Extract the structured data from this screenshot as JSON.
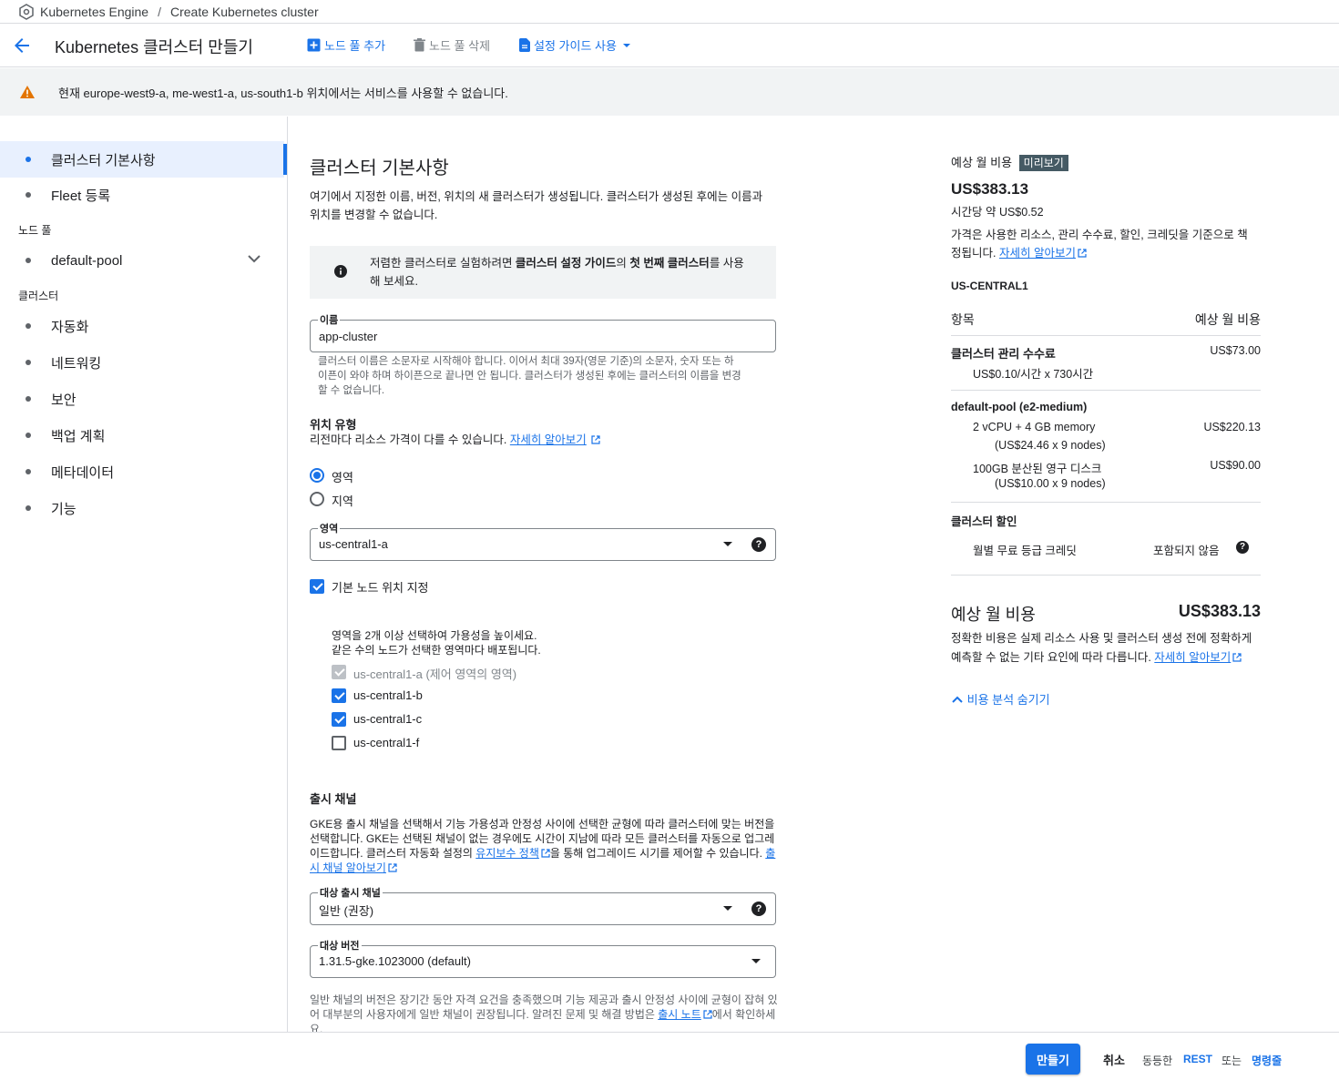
{
  "breadcrumb": {
    "product": "Kubernetes Engine",
    "separator": "/",
    "page": "Create Kubernetes cluster"
  },
  "header": {
    "title": "Kubernetes 클러스터 만들기",
    "add_pool": "노드 풀 추가",
    "delete_pool": "노드 풀 삭제",
    "setup_guide": "설정 가이드 사용"
  },
  "banner": {
    "text": "현재 europe-west9-a, me-west1-a, us-south1-b 위치에서는 서비스를 사용할 수 없습니다."
  },
  "nav": {
    "basics": "클러스터 기본사항",
    "fleet": "Fleet 등록",
    "nodepools_header": "노드 풀",
    "default_pool": "default-pool",
    "cluster_header": "클러스터",
    "automation": "자동화",
    "networking": "네트워킹",
    "security": "보안",
    "backup": "백업 계획",
    "metadata": "메타데이터",
    "features": "기능"
  },
  "form": {
    "heading": "클러스터 기본사항",
    "intro_1": "여기에서 지정한 이름, 버전, 위치의 새 클러스터가 생성됩니다. 클러스터가 생성된 후에는 이름과",
    "intro_2": "위치를 변경할 수 없습니다.",
    "info_line1_a": "저렴한 클러스터로 실험하려면 ",
    "info_line1_b": "클러스터 설정 가이드",
    "info_line1_c": "의 ",
    "info_line1_d": "첫 번째 클러스터",
    "info_line1_e": "를 사용",
    "info_line2": "해 보세요.",
    "name_label": "이름",
    "name_value": "app-cluster",
    "name_hint_1": "클러스터 이름은 소문자로 시작해야 합니다. 이어서 최대 39자(영문 기준)의 소문자, 숫자 또는 하",
    "name_hint_2": "이픈이 와야 하며 하이픈으로 끝나면 안 됩니다. 클러스터가 생성된 후에는 클러스터의 이름을 변경",
    "name_hint_3": "할 수 없습니다.",
    "location_type_label": "위치 유형",
    "location_type_desc": "리전마다 리소스 가격이 다를 수 있습니다.",
    "learn_more": "자세히 알아보기",
    "radio_zonal": "영역",
    "radio_regional": "지역",
    "zone_label": "영역",
    "zone_value": "us-central1-a",
    "default_node_locations": "기본 노드 위치 지정",
    "zones_desc_1": "영역을 2개 이상 선택하여 가용성을 높이세요.",
    "zones_desc_2": "같은 수의 노드가 선택한 영역마다 배포됩니다.",
    "zone_a": "us-central1-a (제어 영역의 영역)",
    "zone_b": "us-central1-b",
    "zone_c": "us-central1-c",
    "zone_f": "us-central1-f",
    "release_channel_heading": "출시 채널",
    "rc_desc_1": "GKE용 출시 채널을 선택해서 기능 가용성과 안정성 사이에 선택한 균형에 따라 클러스터에 맞는 버전을",
    "rc_desc_2": "선택합니다. GKE는 선택된 채널이 없는 경우에도 시간이 지남에 따라 모든 클러스터를 자동으로 업그레",
    "rc_desc_3a": "이드합니다. 클러스터 자동화 설정의 ",
    "rc_maint_link": "유지보수 정책",
    "rc_desc_3b": "을 통해 업그레이드 시기를 제어할 수 있습니다. ",
    "rc_link_a": "출",
    "rc_link_b": "시 채널 알아보기",
    "target_channel_label": "대상 출시 채널",
    "target_channel_value": "일반 (권장)",
    "target_version_label": "대상 버전",
    "target_version_value": "1.31.5-gke.1023000 (default)",
    "ver_hint_1": "일반 채널의 버전은 장기간 동안 자격 요건을 충족했으며 기능 제공과 출시 안정성 사이에 균형이 잡혀 있",
    "ver_hint_2a": "어 대부분의 사용자에게 일반 채널이 권장됩니다. 알려진 문제 및 해결 방법은 ",
    "release_notes": "출시 노트",
    "ver_hint_2b": "에서 확인하세",
    "ver_hint_3": "요."
  },
  "cost": {
    "label": "예상 월 비용",
    "preview_badge": "미리보기",
    "total": "US$383.13",
    "hourly": "시간당 약 US$0.52",
    "basis_1": "가격은 사용한 리소스, 관리 수수료, 할인, 크레딧을 기준으로 책",
    "basis_2": "정됩니다.",
    "learn_more": "자세히 알아보기",
    "region": "US-CENTRAL1",
    "col_item": "항목",
    "col_cost": "예상 월 비용",
    "mgmt_fee": "클러스터 관리 수수료",
    "mgmt_fee_value": "US$73.00",
    "mgmt_fee_detail": "US$0.10/시간 x 730시간",
    "pool_title": "default-pool (e2-medium)",
    "pool_compute": "2 vCPU + 4 GB memory",
    "pool_compute_value": "US$220.13",
    "pool_compute_detail": "(US$24.46 x 9 nodes)",
    "pool_disk": "100GB 분산된 영구 디스크",
    "pool_disk_value": "US$90.00",
    "pool_disk_detail": "(US$10.00 x 9 nodes)",
    "discount_title": "클러스터 할인",
    "free_tier": "월별 무료 등급 크레딧",
    "free_tier_value": "포함되지 않음",
    "total_label": "예상 월 비용",
    "total_value": "US$383.13",
    "disclaimer_1": "정확한 비용은 실제 리소스 사용 및 클러스터 생성 전에 정확하게",
    "disclaimer_2": "예측할 수 없는 기타 요인에 따라 다릅니다.",
    "hide_breakdown": "비용 분석 숨기기"
  },
  "footer": {
    "create": "만들기",
    "cancel": "취소",
    "equivalent": "동등한",
    "rest": "REST",
    "or": "또는",
    "command_line": "명령줄"
  },
  "colors": {
    "primary": "#1a73e8",
    "warning": "#e37400",
    "banner_bg": "#f1f3f4"
  }
}
